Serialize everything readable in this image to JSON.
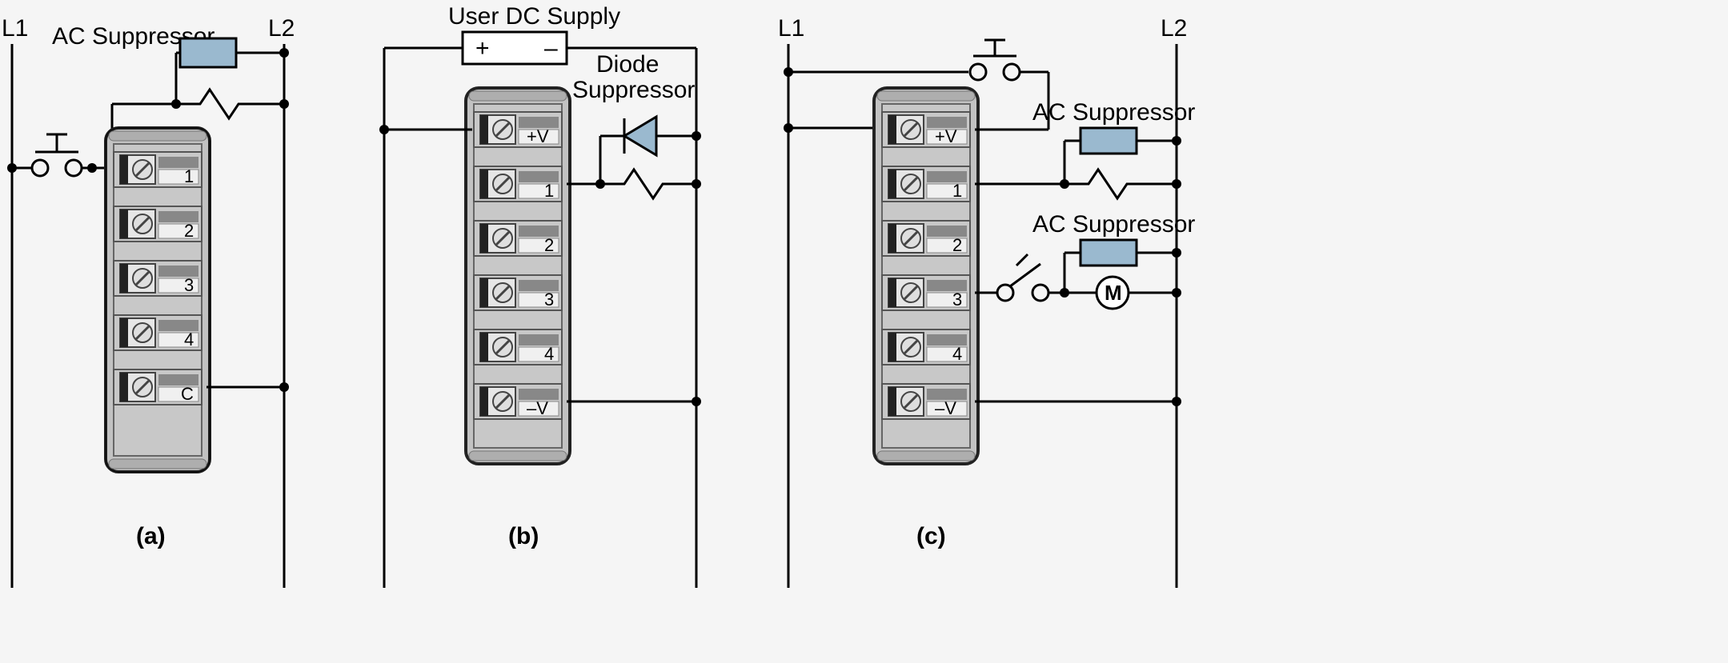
{
  "l1": "L1",
  "l2": "L2",
  "ac_suppressor": "AC Suppressor",
  "user_dc": "User DC Supply",
  "diode_suppressor": "Diode",
  "diode_suppressor2": "Suppressor",
  "motor": "M",
  "sub_a": "(a)",
  "sub_b": "(b)",
  "sub_c": "(c)",
  "term": {
    "plusV": "+V",
    "minusV": "–V",
    "t1": "1",
    "t2": "2",
    "t3": "3",
    "t4": "4",
    "tC": "C"
  }
}
